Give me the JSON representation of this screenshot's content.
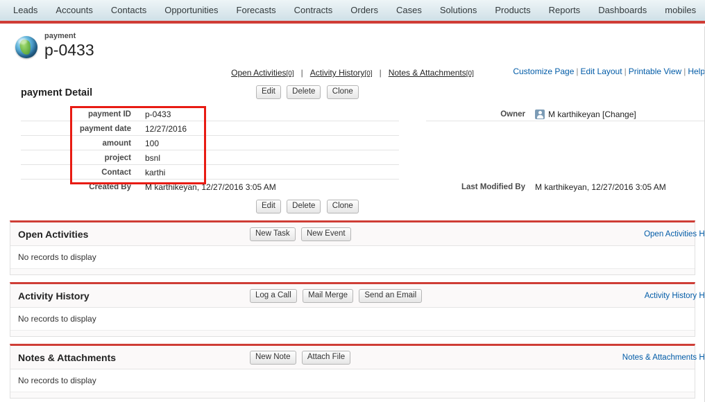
{
  "tabs": [
    {
      "label": "Leads"
    },
    {
      "label": "Accounts"
    },
    {
      "label": "Contacts"
    },
    {
      "label": "Opportunities"
    },
    {
      "label": "Forecasts"
    },
    {
      "label": "Contracts"
    },
    {
      "label": "Orders"
    },
    {
      "label": "Cases"
    },
    {
      "label": "Solutions"
    },
    {
      "label": "Products"
    },
    {
      "label": "Reports"
    },
    {
      "label": "Dashboards"
    },
    {
      "label": "mobiles"
    }
  ],
  "add_tab_label": "+",
  "record": {
    "object_type": "payment",
    "name": "p-0433"
  },
  "utility_links": [
    {
      "label": "Customize Page"
    },
    {
      "label": "Edit Layout"
    },
    {
      "label": "Printable View"
    },
    {
      "label": "Help"
    }
  ],
  "anchor_links": [
    {
      "label": "Open Activities",
      "count": "[0]"
    },
    {
      "label": "Activity History",
      "count": "[0]"
    },
    {
      "label": "Notes & Attachments",
      "count": "[0]"
    }
  ],
  "detail": {
    "title": "payment Detail",
    "buttons": [
      {
        "label": "Edit"
      },
      {
        "label": "Delete"
      },
      {
        "label": "Clone"
      }
    ],
    "left_fields": [
      {
        "label": "payment ID",
        "value": "p-0433"
      },
      {
        "label": "payment date",
        "value": "12/27/2016"
      },
      {
        "label": "amount",
        "value": "100"
      },
      {
        "label": "project",
        "value": "bsnl"
      },
      {
        "label": "Contact",
        "value": "karthi"
      },
      {
        "label": "Created By",
        "value": "M karthikeyan, 12/27/2016 3:05 AM"
      }
    ],
    "owner": {
      "label": "Owner",
      "value": "M karthikeyan [Change]"
    },
    "last_modified": {
      "label": "Last Modified By",
      "value": "M karthikeyan, 12/27/2016 3:05 AM"
    }
  },
  "related_lists": [
    {
      "title": "Open Activities",
      "buttons": [
        {
          "label": "New Task"
        },
        {
          "label": "New Event"
        }
      ],
      "link": "Open Activities Help",
      "empty_text": "No records to display"
    },
    {
      "title": "Activity History",
      "buttons": [
        {
          "label": "Log a Call"
        },
        {
          "label": "Mail Merge"
        },
        {
          "label": "Send an Email"
        }
      ],
      "link": "Activity History Help",
      "empty_text": "No records to display"
    },
    {
      "title": "Notes & Attachments",
      "buttons": [
        {
          "label": "New Note"
        },
        {
          "label": "Attach File"
        }
      ],
      "link": "Notes & Attachments Help",
      "empty_text": "No records to display"
    }
  ],
  "colors": {
    "accent_red": "#cf3d36",
    "annotation_red": "#e81b13",
    "link_blue": "#015ba7",
    "tabbar_top": "#eef5f7"
  }
}
